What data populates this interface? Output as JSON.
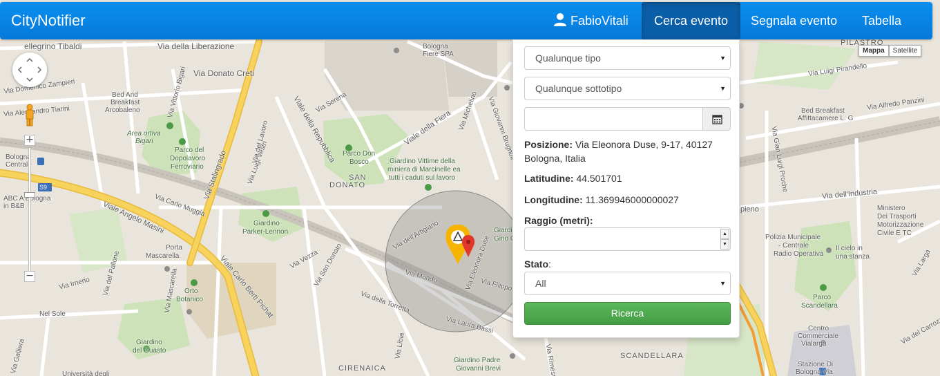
{
  "app": {
    "brand": "CityNotifier"
  },
  "nav": {
    "user": "FabioVitali",
    "search": "Cerca evento",
    "report": "Segnala evento",
    "table": "Tabella"
  },
  "map_type": {
    "map": "Mappa",
    "satellite": "Satellite",
    "selected": "Mappa"
  },
  "form": {
    "type_select": "Qualunque tipo",
    "subtype_select": "Qualunque sottotipo",
    "date_value": "",
    "position_label": "Posizione:",
    "position_value": "Via Eleonora Duse, 9-17, 40127 Bologna, Italia",
    "latitude_label": "Latitudine:",
    "latitude_value": "44.501701",
    "longitude_label": "Longitudine:",
    "longitude_value": "11.369946000000027",
    "radius_label": "Raggio (metri):",
    "radius_value": "",
    "status_label": "Stato",
    "status_colon": ":",
    "status_value": "All",
    "submit": "Ricerca"
  },
  "map_labels": {
    "pellegrino": "ellegrino Tibaldi",
    "liberazione": "Via della Liberazione",
    "donato_creti": "Via Donato Creti",
    "bologna_fiere_1": "Bologna",
    "bologna_fiere_2": "Fiere SPA",
    "pilastro": "PILASTRO",
    "luigi_pirandello": "Via Luigi Pirandello",
    "domenico_zampieri": "Via Domenico Zampieri",
    "bed_breakfast_arcobaleno_1": "Bed And",
    "bed_breakfast_arcobaleno_2": "Breakfast",
    "bed_breakfast_arcobaleno_3": "Arcobaleno",
    "alessandro_tiarini": "Via Alessandro Tiarini",
    "vittorio_bigari": "Via Vittorio Bigari",
    "area_ortiva_1": "Area ortiva",
    "area_ortiva_2": "Bigari",
    "parco_dopolavoro_1": "Parco del",
    "parco_dopolavoro_2": "Dopolavoro",
    "parco_dopolavoro_3": "Ferroviario",
    "viale_repubblica": "Viale della Repubblica",
    "via_serena": "Via Serena",
    "viale_fiera": "Viale della Fiera",
    "via_michelino": "Via Michelino",
    "via_giovanni_brugnoli": "Via Giovanni Brugnoli",
    "bed_breakfast_affittacamere_1": "Bed Breakfast",
    "bed_breakfast_affittacamere_2": "Affittacamere L. G",
    "alfredo_panzini": "Via Alfredo Panzini",
    "gian_luigi_proche": "Via Gian Luigi Proche",
    "bologna_centrale_1": "Bologna",
    "bologna_centrale_2": "Centrale",
    "via_stalingrado": "Via Stalingrado",
    "via_luigi_vestri": "Via Luigi Vestri",
    "parco_don_bosco_1": "Parco Don",
    "parco_don_bosco_2": "Bosco",
    "giardino_vittime_1": "Giardino Vittime della",
    "giardino_vittime_2": "miniera di Marcinelle ea",
    "giardino_vittime_3": "tutti i caduti sul lavoro",
    "san_donato_1": "SAN",
    "san_donato_2": "DONATO",
    "s9": "S9",
    "abc_bologna_1": "ABC A Bologna",
    "abc_bologna_2": "in B&B",
    "viale_angelo_masini": "Viale Angelo Masini",
    "via_carlo_muggia": "Via Carlo Muggia",
    "via_del_lavoro": "Via del Lavoro",
    "via_dellindustria": "Via dell'Industria",
    "ministero_1": "Ministero",
    "ministero_2": "Dei Trasporti",
    "ministero_3": "Motorizzazione",
    "ministero_4": "Civile E TC",
    "giardino_parker_1": "Giardino",
    "giardino_parker_2": "Parker-Lennon",
    "via_dellartigiano": "Via dell'Artigiano",
    "giardino_gino_1": "Giardino",
    "giardino_gino_2": "Gino C",
    "polizia_1": "Polizia Municipale",
    "polizia_2": "- Centrale",
    "polizia_3": "Radio Operativa",
    "cielo_1": "Il cielo in",
    "cielo_2": "una stanza",
    "porta_mascarella_1": "Porta",
    "porta_mascarella_2": "Mascarella",
    "viale_carlo_berti": "Viale Carlo Berti Pichat",
    "via_vezza": "Via Vezza",
    "via_san_donato": "Via San Donato",
    "via_del_pallone": "Via del Pallone",
    "via_irnerio": "Via Irnerio",
    "via_eleonora_duse": "Via Eleonora Duse",
    "via_mondo": "Via Mondo",
    "via_filippo_bero": "Via Filippo Bero",
    "via_della_torretta": "Via della Torretta",
    "via_mascarella": "Via Mascarella",
    "orto_botanico_1": "Orto",
    "orto_botanico_2": "Botanico",
    "nel_sole": "Nel Sole",
    "via_galliera": "Via Galliera",
    "via_libia": "Via Libia",
    "via_laura_bassi": "Via Laura Bassi",
    "via_rimesse": "Via Rimesse",
    "parco_scandellara_1": "Parco",
    "parco_scandellara_2": "Scandellara",
    "centro_commerciale_1": "Centro",
    "centro_commerciale_2": "Commerciale",
    "centro_commerciale_3": "Vialarga",
    "via_larga": "Via Larga",
    "via_carrozzaio": "Via del Carrozzaio",
    "giardino_guasto_1": "Giardino",
    "giardino_guasto_2": "del Guasto",
    "universita": "Università degli",
    "giardino_padre_1": "Giardino Padre",
    "giardino_padre_2": "Giovanni Brevi",
    "cirenaica": "CIRENAICA",
    "scandellara": "SCANDELLARA",
    "stazione_1": "Stazione Di",
    "stazione_2": "Bologna Via",
    "pieno": "pieno"
  }
}
